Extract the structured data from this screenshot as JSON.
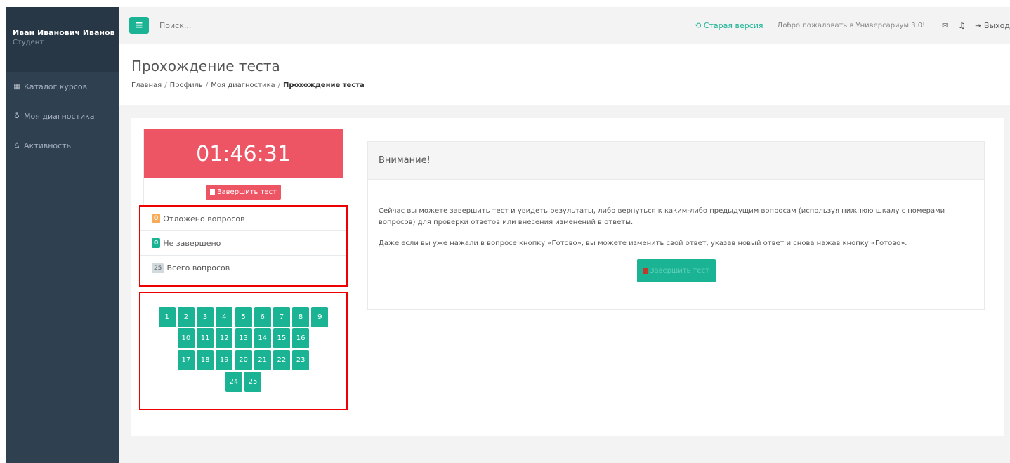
{
  "user": {
    "name": "Иван Иванович Иванов",
    "role": "Студент"
  },
  "sidebar": {
    "items": [
      {
        "icon": "grid-icon",
        "glyph": "▦",
        "label": "Каталог курсов"
      },
      {
        "icon": "stethoscope-icon",
        "glyph": "♁",
        "label": "Моя диагностика"
      },
      {
        "icon": "user-icon",
        "glyph": "♙",
        "label": "Активность"
      }
    ]
  },
  "topbar": {
    "menu_glyph": "≡",
    "search_placeholder": "Поиск...",
    "old_version": "Старая версия",
    "welcome": "Добро пожаловать в Универсариум 3.0!",
    "logout": "Выход"
  },
  "page": {
    "title": "Прохождение теста",
    "breadcrumb": [
      "Главная",
      "Профиль",
      "Моя диагностика",
      "Прохождение теста"
    ]
  },
  "timer": {
    "value": "01:46:31",
    "finish_label": "Завершить тест"
  },
  "stats": [
    {
      "count": "0",
      "label": "Отложено вопросов",
      "color": "orange"
    },
    {
      "count": "0",
      "label": "Не завершено",
      "color": "green"
    },
    {
      "count": "25",
      "label": "Всего вопросов",
      "color": "gray"
    }
  ],
  "questions": [
    "1",
    "2",
    "3",
    "4",
    "5",
    "6",
    "7",
    "8",
    "9",
    "10",
    "11",
    "12",
    "13",
    "14",
    "15",
    "16",
    "17",
    "18",
    "19",
    "20",
    "21",
    "22",
    "23",
    "24",
    "25"
  ],
  "attention": {
    "title": "Внимание!",
    "paragraph1": "Сейчас вы можете завершить тест и увидеть результаты, либо вернуться к каким-либо предыдущим вопросам (используя нижнюю шкалу с номерами вопросов) для проверки ответов или внесения изменений в ответы.",
    "paragraph2": "Даже если вы уже нажали в вопросе кнопку «Готово», вы можете изменить свой ответ, указав новый ответ и снова нажав кнопку «Готово».",
    "finish_label": "Завершить тест"
  },
  "colors": {
    "accent": "#1ab394",
    "danger": "#ed5565",
    "sidebar": "#2f4050",
    "highlight": "#e00000"
  }
}
